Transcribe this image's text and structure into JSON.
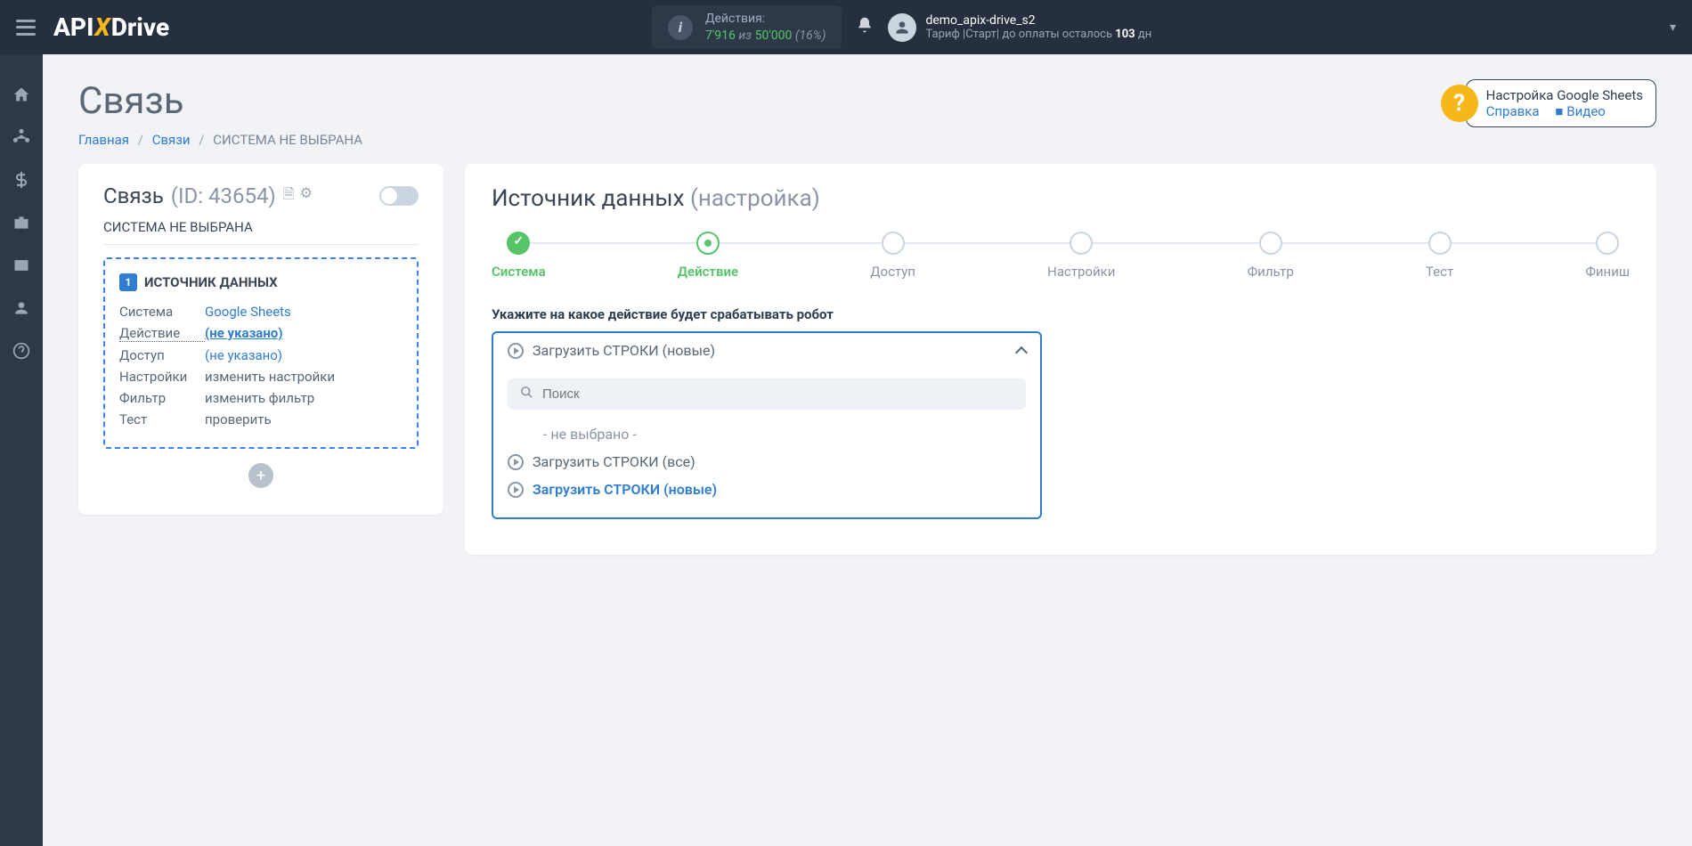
{
  "header": {
    "logo": {
      "api": "API",
      "x": "X",
      "drive": "Drive"
    },
    "actions": {
      "label": "Действия:",
      "used": "7'916",
      "sep": "из",
      "limit": "50'000",
      "pct": "(16%)"
    },
    "user": {
      "name": "demo_apix-drive_s2",
      "tariff_prefix": "Тариф |Старт|  до оплаты осталось ",
      "days": "103",
      "days_suffix": " дн"
    }
  },
  "page": {
    "title": "Связь",
    "breadcrumb": {
      "home": "Главная",
      "links": "Связи",
      "current": "СИСТЕМА НЕ ВЫБРАНА"
    },
    "help": {
      "title": "Настройка Google Sheets",
      "ref": "Справка",
      "video": "Видео"
    }
  },
  "left": {
    "conn_label": "Связь",
    "conn_id": "(ID: 43654)",
    "sys_not_selected": "СИСТЕМА НЕ ВЫБРАНА",
    "source_title": "ИСТОЧНИК ДАННЫХ",
    "rows": [
      {
        "key": "Система",
        "val": "Google Sheets",
        "link": true
      },
      {
        "key": "Действие",
        "val": "(не указано)",
        "link": true,
        "underline": true,
        "keydot": true
      },
      {
        "key": "Доступ",
        "val": "(не указано)",
        "link": true
      },
      {
        "key": "Настройки",
        "val": "изменить настройки"
      },
      {
        "key": "Фильтр",
        "val": "изменить фильтр"
      },
      {
        "key": "Тест",
        "val": "проверить"
      }
    ]
  },
  "right": {
    "title": "Источник данных",
    "subtitle": "(настройка)",
    "steps": [
      "Система",
      "Действие",
      "Доступ",
      "Настройки",
      "Фильтр",
      "Тест",
      "Финиш"
    ],
    "instruction": "Укажите на какое действие будет срабатывать робот",
    "dropdown": {
      "selected": "Загрузить СТРОКИ (новые)",
      "search_placeholder": "Поиск",
      "options": [
        {
          "label": "- не выбрано -",
          "none": true
        },
        {
          "label": "Загрузить СТРОКИ (все)"
        },
        {
          "label": "Загрузить СТРОКИ (новые)",
          "selected": true
        }
      ]
    }
  }
}
